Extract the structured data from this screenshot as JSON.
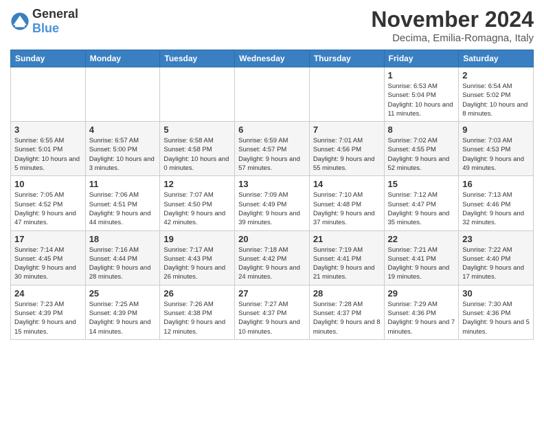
{
  "logo": {
    "general": "General",
    "blue": "Blue"
  },
  "header": {
    "month": "November 2024",
    "location": "Decima, Emilia-Romagna, Italy"
  },
  "weekdays": [
    "Sunday",
    "Monday",
    "Tuesday",
    "Wednesday",
    "Thursday",
    "Friday",
    "Saturday"
  ],
  "weeks": [
    [
      {
        "day": "",
        "info": ""
      },
      {
        "day": "",
        "info": ""
      },
      {
        "day": "",
        "info": ""
      },
      {
        "day": "",
        "info": ""
      },
      {
        "day": "",
        "info": ""
      },
      {
        "day": "1",
        "info": "Sunrise: 6:53 AM\nSunset: 5:04 PM\nDaylight: 10 hours and 11 minutes."
      },
      {
        "day": "2",
        "info": "Sunrise: 6:54 AM\nSunset: 5:02 PM\nDaylight: 10 hours and 8 minutes."
      }
    ],
    [
      {
        "day": "3",
        "info": "Sunrise: 6:55 AM\nSunset: 5:01 PM\nDaylight: 10 hours and 5 minutes."
      },
      {
        "day": "4",
        "info": "Sunrise: 6:57 AM\nSunset: 5:00 PM\nDaylight: 10 hours and 3 minutes."
      },
      {
        "day": "5",
        "info": "Sunrise: 6:58 AM\nSunset: 4:58 PM\nDaylight: 10 hours and 0 minutes."
      },
      {
        "day": "6",
        "info": "Sunrise: 6:59 AM\nSunset: 4:57 PM\nDaylight: 9 hours and 57 minutes."
      },
      {
        "day": "7",
        "info": "Sunrise: 7:01 AM\nSunset: 4:56 PM\nDaylight: 9 hours and 55 minutes."
      },
      {
        "day": "8",
        "info": "Sunrise: 7:02 AM\nSunset: 4:55 PM\nDaylight: 9 hours and 52 minutes."
      },
      {
        "day": "9",
        "info": "Sunrise: 7:03 AM\nSunset: 4:53 PM\nDaylight: 9 hours and 49 minutes."
      }
    ],
    [
      {
        "day": "10",
        "info": "Sunrise: 7:05 AM\nSunset: 4:52 PM\nDaylight: 9 hours and 47 minutes."
      },
      {
        "day": "11",
        "info": "Sunrise: 7:06 AM\nSunset: 4:51 PM\nDaylight: 9 hours and 44 minutes."
      },
      {
        "day": "12",
        "info": "Sunrise: 7:07 AM\nSunset: 4:50 PM\nDaylight: 9 hours and 42 minutes."
      },
      {
        "day": "13",
        "info": "Sunrise: 7:09 AM\nSunset: 4:49 PM\nDaylight: 9 hours and 39 minutes."
      },
      {
        "day": "14",
        "info": "Sunrise: 7:10 AM\nSunset: 4:48 PM\nDaylight: 9 hours and 37 minutes."
      },
      {
        "day": "15",
        "info": "Sunrise: 7:12 AM\nSunset: 4:47 PM\nDaylight: 9 hours and 35 minutes."
      },
      {
        "day": "16",
        "info": "Sunrise: 7:13 AM\nSunset: 4:46 PM\nDaylight: 9 hours and 32 minutes."
      }
    ],
    [
      {
        "day": "17",
        "info": "Sunrise: 7:14 AM\nSunset: 4:45 PM\nDaylight: 9 hours and 30 minutes."
      },
      {
        "day": "18",
        "info": "Sunrise: 7:16 AM\nSunset: 4:44 PM\nDaylight: 9 hours and 28 minutes."
      },
      {
        "day": "19",
        "info": "Sunrise: 7:17 AM\nSunset: 4:43 PM\nDaylight: 9 hours and 26 minutes."
      },
      {
        "day": "20",
        "info": "Sunrise: 7:18 AM\nSunset: 4:42 PM\nDaylight: 9 hours and 24 minutes."
      },
      {
        "day": "21",
        "info": "Sunrise: 7:19 AM\nSunset: 4:41 PM\nDaylight: 9 hours and 21 minutes."
      },
      {
        "day": "22",
        "info": "Sunrise: 7:21 AM\nSunset: 4:41 PM\nDaylight: 9 hours and 19 minutes."
      },
      {
        "day": "23",
        "info": "Sunrise: 7:22 AM\nSunset: 4:40 PM\nDaylight: 9 hours and 17 minutes."
      }
    ],
    [
      {
        "day": "24",
        "info": "Sunrise: 7:23 AM\nSunset: 4:39 PM\nDaylight: 9 hours and 15 minutes."
      },
      {
        "day": "25",
        "info": "Sunrise: 7:25 AM\nSunset: 4:39 PM\nDaylight: 9 hours and 14 minutes."
      },
      {
        "day": "26",
        "info": "Sunrise: 7:26 AM\nSunset: 4:38 PM\nDaylight: 9 hours and 12 minutes."
      },
      {
        "day": "27",
        "info": "Sunrise: 7:27 AM\nSunset: 4:37 PM\nDaylight: 9 hours and 10 minutes."
      },
      {
        "day": "28",
        "info": "Sunrise: 7:28 AM\nSunset: 4:37 PM\nDaylight: 9 hours and 8 minutes."
      },
      {
        "day": "29",
        "info": "Sunrise: 7:29 AM\nSunset: 4:36 PM\nDaylight: 9 hours and 7 minutes."
      },
      {
        "day": "30",
        "info": "Sunrise: 7:30 AM\nSunset: 4:36 PM\nDaylight: 9 hours and 5 minutes."
      }
    ]
  ]
}
